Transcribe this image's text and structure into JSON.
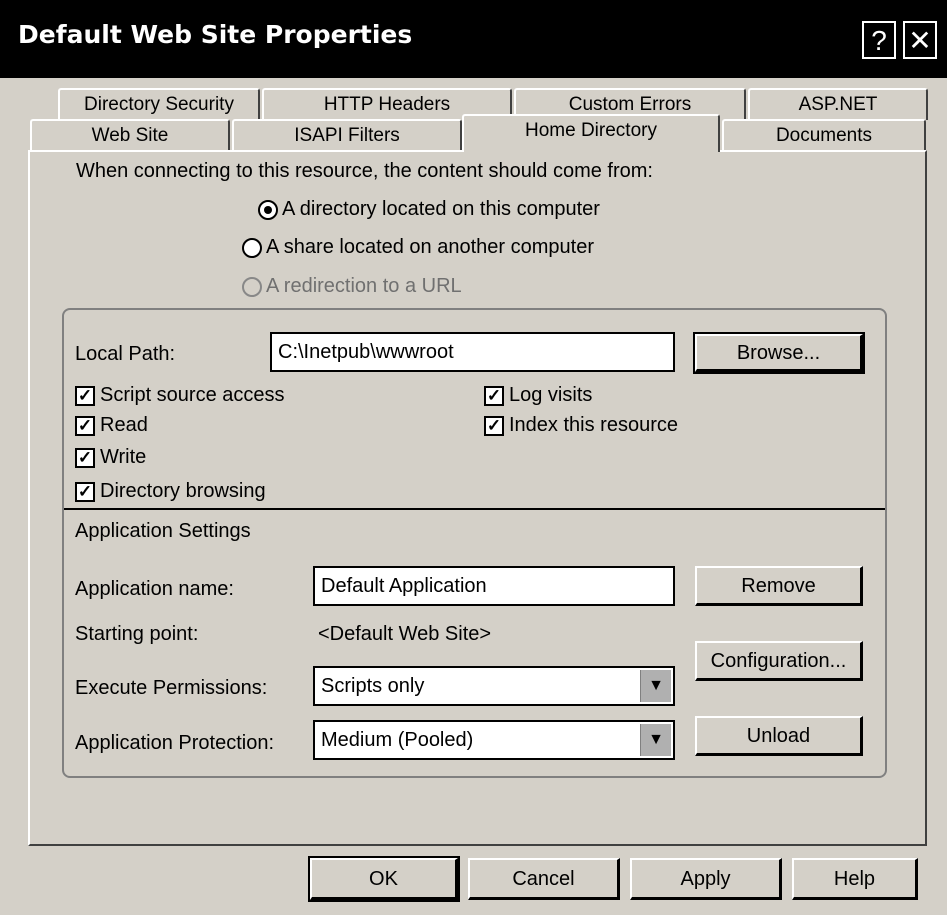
{
  "window": {
    "title": "Default Web Site Properties",
    "help_glyph": "?",
    "close_glyph": "✕"
  },
  "tabs_row1": [
    "Directory Security",
    "HTTP Headers",
    "Custom Errors",
    "ASP.NET"
  ],
  "tabs_row2": [
    "Web Site",
    "ISAPI Filters",
    "Home Directory",
    "Documents"
  ],
  "active_tab": "Home Directory",
  "content": {
    "prompt": "When connecting to this resource, the content should come from:",
    "options": [
      {
        "label": "A directory located on this computer",
        "checked": true,
        "disabled": false
      },
      {
        "label": "A share located on another computer",
        "checked": false,
        "disabled": false
      },
      {
        "label": "A redirection to a URL",
        "checked": false,
        "disabled": true
      }
    ]
  },
  "local": {
    "path_label": "Local Path:",
    "path_value": "C:\\Inetpub\\wwwroot",
    "browse": "Browse..."
  },
  "checks_left": [
    {
      "label": "Script source access",
      "checked": true
    },
    {
      "label": "Read",
      "checked": true
    },
    {
      "label": "Write",
      "checked": true
    },
    {
      "label": "Directory browsing",
      "checked": true
    }
  ],
  "checks_right": [
    {
      "label": "Log visits",
      "checked": true
    },
    {
      "label": "Index this resource",
      "checked": true
    }
  ],
  "app": {
    "section_label": "Application Settings",
    "name_label": "Application name:",
    "name_value": "Default Application",
    "remove": "Remove",
    "start_label": "Starting point:",
    "start_value": "<Default Web Site>",
    "config": "Configuration...",
    "exec_label": "Execute Permissions:",
    "exec_value": "Scripts only",
    "protect_label": "Application Protection:",
    "protect_value": "Medium (Pooled)",
    "unload": "Unload"
  },
  "buttons": {
    "ok": "OK",
    "cancel": "Cancel",
    "apply": "Apply",
    "help": "Help"
  },
  "check_glyph": "✓",
  "dropdown_glyph": "▼"
}
